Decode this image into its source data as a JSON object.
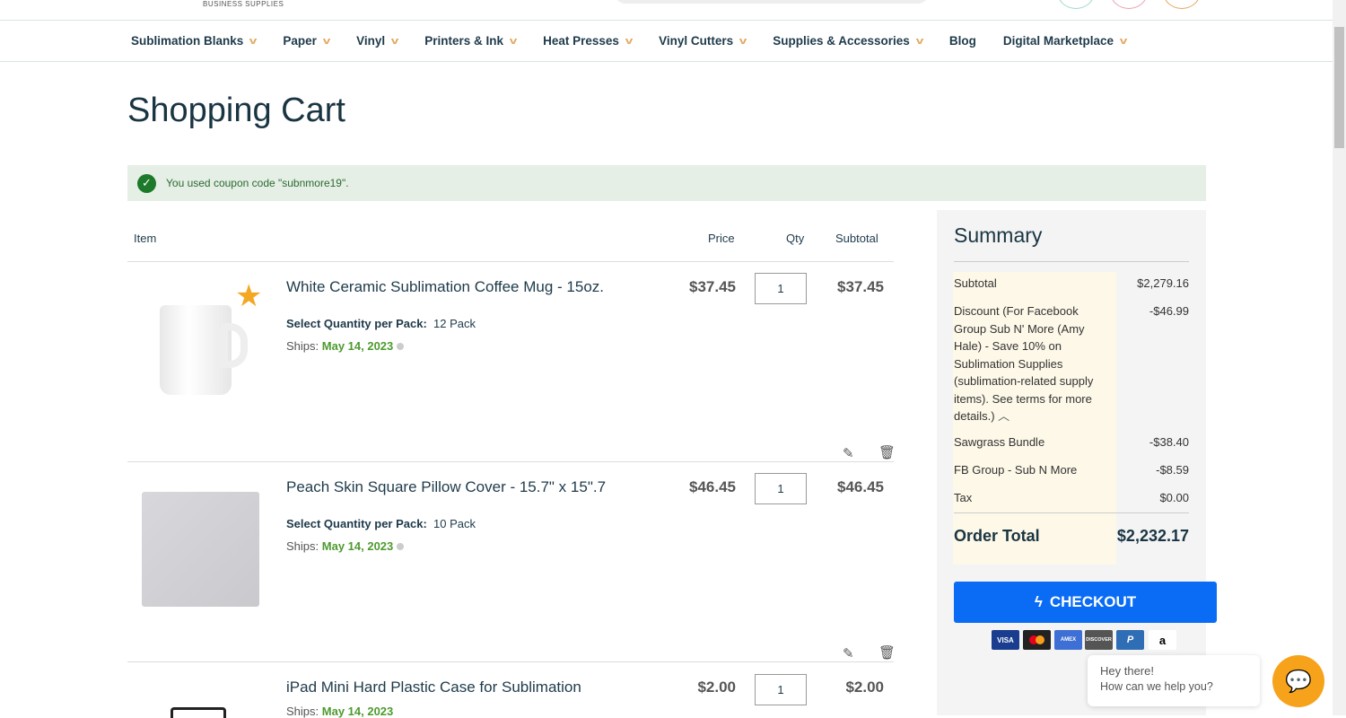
{
  "header": {
    "logo_subtitle": "BUSINESS SUPPLIES"
  },
  "nav": [
    "Sublimation Blanks",
    "Paper",
    "Vinyl",
    "Printers & Ink",
    "Heat Presses",
    "Vinyl Cutters",
    "Supplies & Accessories",
    "Blog",
    "Digital Marketplace"
  ],
  "page_title": "Shopping Cart",
  "notice": "You used coupon code \"subnmore19\".",
  "table": {
    "item": "Item",
    "price": "Price",
    "qty": "Qty",
    "subtotal": "Subtotal"
  },
  "items": [
    {
      "name": "White Ceramic Sublimation Coffee Mug - 15oz.",
      "option_label": "Select Quantity per Pack:",
      "option_value": "12 Pack",
      "ships_label": "Ships:",
      "ships_date": "May 14, 2023",
      "price": "$37.45",
      "qty": "1",
      "subtotal": "$37.45"
    },
    {
      "name": "Peach Skin Square Pillow Cover - 15.7\" x 15\".7",
      "option_label": "Select Quantity per Pack:",
      "option_value": "10 Pack",
      "ships_label": "Ships:",
      "ships_date": "May 14, 2023",
      "price": "$46.45",
      "qty": "1",
      "subtotal": "$46.45"
    },
    {
      "name": "iPad Mini Hard Plastic Case for Sublimation",
      "ships_label": "Ships:",
      "ships_date": "May 14, 2023",
      "price": "$2.00",
      "qty": "1",
      "subtotal": "$2.00"
    }
  ],
  "summary": {
    "title": "Summary",
    "rows": [
      {
        "label": "Subtotal",
        "value": "$2,279.16"
      },
      {
        "label": "Discount (For Facebook Group Sub N' More (Amy Hale) - Save 10% on Sublimation Supplies (sublimation-related supply items). See terms for more details.)",
        "value": "-$46.99"
      },
      {
        "label": "Sawgrass Bundle",
        "value": "-$38.40"
      },
      {
        "label": "FB Group - Sub N More",
        "value": "-$8.59"
      },
      {
        "label": "Tax",
        "value": "$0.00"
      }
    ],
    "total_label": "Order Total",
    "total_value": "$2,232.17",
    "checkout": "CHECKOUT",
    "cards": [
      "VISA",
      "MC",
      "AMEX",
      "DISCOVER",
      "P",
      "a"
    ]
  },
  "chat": {
    "line1": "Hey there!",
    "line2": "How can we help you?"
  },
  "colors": {
    "accent": "#0a6cf5",
    "ships": "#4e9a2f",
    "chat": "#f7a21b"
  }
}
